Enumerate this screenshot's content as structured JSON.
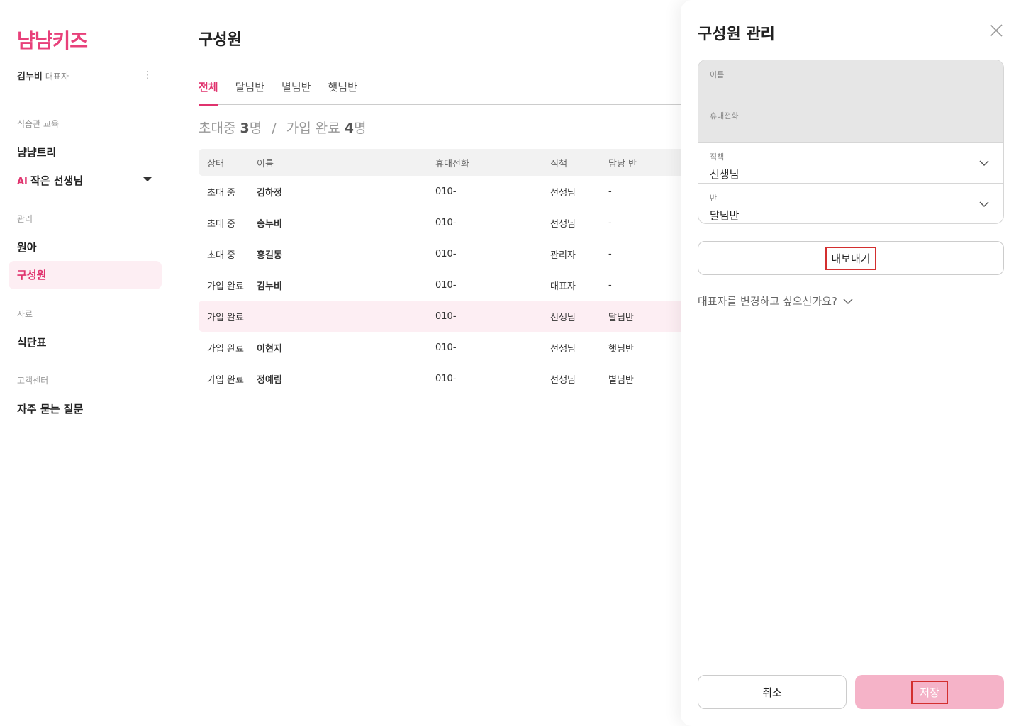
{
  "sidebar": {
    "logo": "냠냠키즈",
    "user_name": "김누비",
    "user_role": "대표자",
    "sections": [
      {
        "title": "식습관 교육"
      },
      {
        "title": "관리"
      },
      {
        "title": "자료"
      },
      {
        "title": "고객센터"
      }
    ],
    "items": {
      "nyam_tree": "냠냠트리",
      "ai_badge": "AI",
      "small_teacher": "작은 선생님",
      "children": "원아",
      "members": "구성원",
      "menu": "식단표",
      "faq": "자주 묻는 질문"
    }
  },
  "main": {
    "title": "구성원",
    "tabs": [
      {
        "label": "전체"
      },
      {
        "label": "달님반"
      },
      {
        "label": "별님반"
      },
      {
        "label": "햇님반"
      }
    ],
    "summary": {
      "invited_label": "초대중",
      "invited_count": "3",
      "invited_unit": "명",
      "sep": "/",
      "joined_label": "가입 완료",
      "joined_count": "4",
      "joined_unit": "명"
    },
    "table": {
      "headers": {
        "status": "상태",
        "name": "이름",
        "phone": "휴대전화",
        "role": "직책",
        "class": "담당 반"
      },
      "rows": [
        {
          "status": "초대 중",
          "name": "김하정",
          "phone": "010-",
          "role": "선생님",
          "class": "-"
        },
        {
          "status": "초대 중",
          "name": "송누비",
          "phone": "010-",
          "role": "선생님",
          "class": "-"
        },
        {
          "status": "초대 중",
          "name": "홍길동",
          "phone": "010-",
          "role": "관리자",
          "class": "-"
        },
        {
          "status": "가입 완료",
          "name": "김누비",
          "phone": "010-",
          "role": "대표자",
          "class": "-"
        },
        {
          "status": "가입 완료",
          "name": "",
          "phone": "010-",
          "role": "선생님",
          "class": "달님반"
        },
        {
          "status": "가입 완료",
          "name": "이현지",
          "phone": "010-",
          "role": "선생님",
          "class": "햇님반"
        },
        {
          "status": "가입 완료",
          "name": "정예림",
          "phone": "010-",
          "role": "선생님",
          "class": "별님반"
        }
      ]
    }
  },
  "panel": {
    "title": "구성원 관리",
    "fields": {
      "name_label": "이름",
      "name_value": "",
      "phone_label": "휴대전화",
      "phone_value": "",
      "role_label": "직책",
      "role_value": "선생님",
      "class_label": "반",
      "class_value": "달님반"
    },
    "export_label": "내보내기",
    "rep_change_label": "대표자를 변경하고 싶으신가요?",
    "cancel_label": "취소",
    "save_label": "저장"
  },
  "colors": {
    "accent": "#e0336e",
    "highlight_row": "#fdeef3",
    "save_button": "#f5b3c8",
    "annotation_box": "#d32f2f"
  }
}
